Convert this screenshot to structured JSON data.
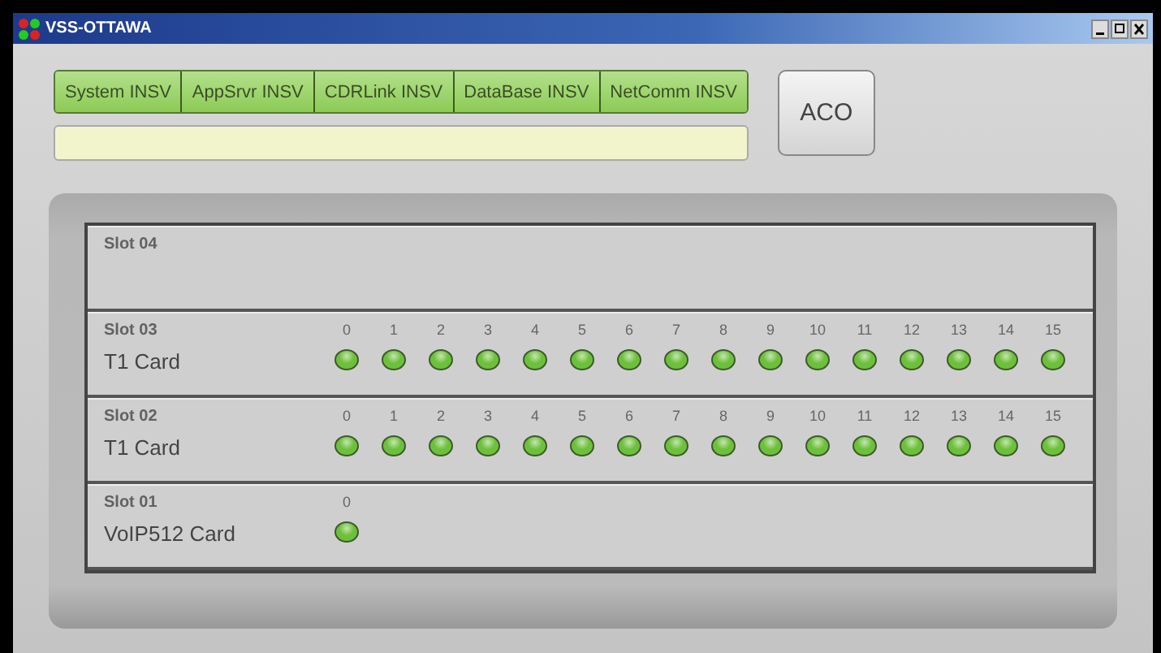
{
  "window": {
    "title": "VSS-OTTAWA"
  },
  "status_tabs": [
    {
      "label": "System INSV"
    },
    {
      "label": "AppSrvr INSV"
    },
    {
      "label": "CDRLink INSV"
    },
    {
      "label": "DataBase INSV"
    },
    {
      "label": "NetComm INSV"
    }
  ],
  "aco_button": {
    "label": "ACO"
  },
  "slots": [
    {
      "slot": "Slot 04"
    },
    {
      "slot": "Slot 03",
      "card": "T1 Card",
      "ports": [
        {
          "label": "0",
          "color": "#6cc03a"
        },
        {
          "label": "1",
          "color": "#6cc03a"
        },
        {
          "label": "2",
          "color": "#6cc03a"
        },
        {
          "label": "3",
          "color": "#6cc03a"
        },
        {
          "label": "4",
          "color": "#6cc03a"
        },
        {
          "label": "5",
          "color": "#6cc03a"
        },
        {
          "label": "6",
          "color": "#6cc03a"
        },
        {
          "label": "7",
          "color": "#6cc03a"
        },
        {
          "label": "8",
          "color": "#6cc03a"
        },
        {
          "label": "9",
          "color": "#6cc03a"
        },
        {
          "label": "10",
          "color": "#6cc03a"
        },
        {
          "label": "11",
          "color": "#6cc03a"
        },
        {
          "label": "12",
          "color": "#6cc03a"
        },
        {
          "label": "13",
          "color": "#6cc03a"
        },
        {
          "label": "14",
          "color": "#6cc03a"
        },
        {
          "label": "15",
          "color": "#6cc03a"
        }
      ]
    },
    {
      "slot": "Slot 02",
      "card": "T1 Card",
      "ports": [
        {
          "label": "0",
          "color": "#6cc03a"
        },
        {
          "label": "1",
          "color": "#6cc03a"
        },
        {
          "label": "2",
          "color": "#6cc03a"
        },
        {
          "label": "3",
          "color": "#6cc03a"
        },
        {
          "label": "4",
          "color": "#6cc03a"
        },
        {
          "label": "5",
          "color": "#6cc03a"
        },
        {
          "label": "6",
          "color": "#6cc03a"
        },
        {
          "label": "7",
          "color": "#6cc03a"
        },
        {
          "label": "8",
          "color": "#6cc03a"
        },
        {
          "label": "9",
          "color": "#6cc03a"
        },
        {
          "label": "10",
          "color": "#6cc03a"
        },
        {
          "label": "11",
          "color": "#6cc03a"
        },
        {
          "label": "12",
          "color": "#6cc03a"
        },
        {
          "label": "13",
          "color": "#6cc03a"
        },
        {
          "label": "14",
          "color": "#6cc03a"
        },
        {
          "label": "15",
          "color": "#6cc03a"
        }
      ]
    },
    {
      "slot": "Slot 01",
      "card": "VoIP512 Card",
      "ports": [
        {
          "label": "0",
          "color": "#6cc03a"
        }
      ]
    }
  ]
}
